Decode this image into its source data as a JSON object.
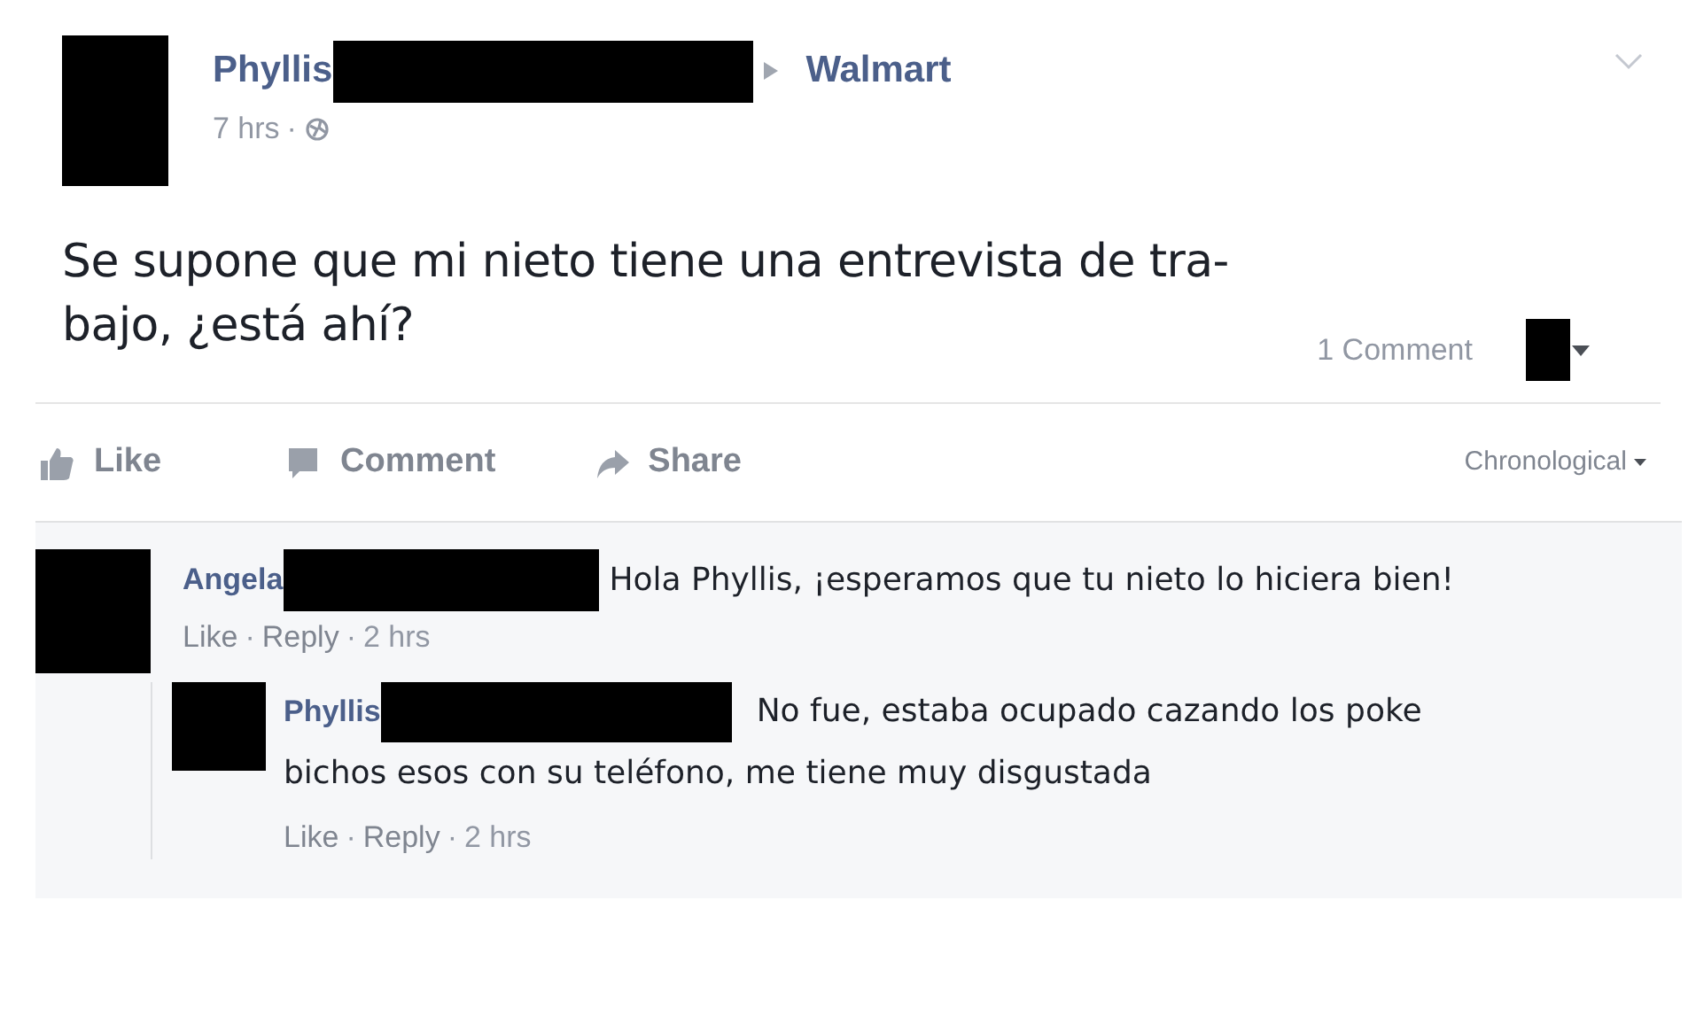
{
  "post": {
    "author": "Phyllis",
    "target": "Walmart",
    "time": "7 hrs",
    "separator": "·",
    "text_lines": [
      "Se supone que mi nieto tiene una entrevista de tra-",
      "bajo, ¿está ahí?"
    ],
    "comment_count": "1 Comment"
  },
  "actions": [
    {
      "kind": "like",
      "label": "Like"
    },
    {
      "kind": "comment",
      "label": "Comment"
    },
    {
      "kind": "share",
      "label": "Share"
    }
  ],
  "sort": {
    "label": "Chronological"
  },
  "comments": [
    {
      "author": "Angela",
      "text": "Hola Phyllis, ¡esperamos que tu nieto lo hiciera bien!",
      "links": [
        "Like",
        "Reply"
      ],
      "separator": "·",
      "time": "2 hrs",
      "replies": [
        {
          "author": "Phyllis",
          "text_lines": [
            "No fue, estaba ocupado cazando los poke",
            "bichos esos con su teléfono, me tiene muy disgustada"
          ],
          "links": [
            "Like",
            "Reply"
          ],
          "separator": "·",
          "time": "2 hrs"
        }
      ]
    }
  ]
}
